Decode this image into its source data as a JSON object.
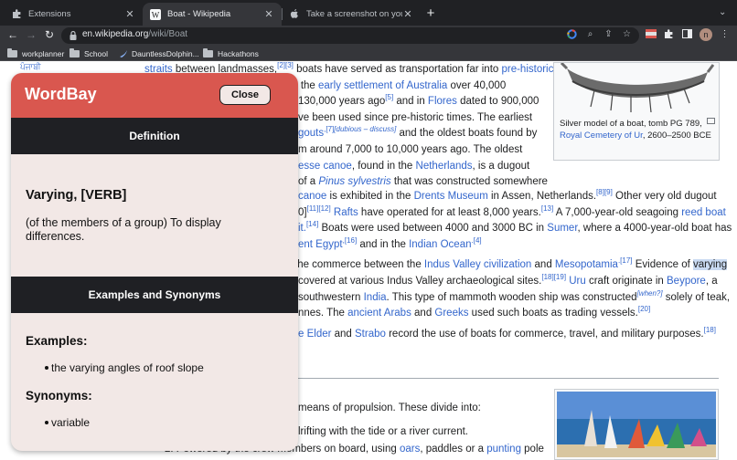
{
  "browser": {
    "tabs": [
      {
        "title": "Extensions",
        "icon": "puzzle-icon"
      },
      {
        "title": "Boat - Wikipedia",
        "icon": "wikipedia-icon"
      },
      {
        "title": "Take a screenshot on your Mac",
        "icon": "apple-icon"
      }
    ],
    "url_host": "en.wikipedia.org",
    "url_path": "/wiki/Boat",
    "bookmarks": [
      "workplanner",
      "School",
      "DauntlessDolphin...",
      "Hackathons"
    ],
    "profile_initial": "n"
  },
  "wiki": {
    "lang_link": "ਪੰਜਾਬੀ",
    "p1": {
      "l1a": "straits",
      "l1b": " between landmasses,",
      "l1c": "[2][3]",
      "l1d": " boats have served as transportation far into ",
      "l1e": "pre-historic",
      "l2a": "such as the ",
      "l2b": "early settlement of Australia",
      "l2c": " over 40,000",
      "l3a": "130,000 years ago",
      "l3b": "[5]",
      "l3c": " and in ",
      "l3d": "Flores",
      "l3e": " dated to 900,000",
      "l4a": "ve been used since pre-historic times. The earliest",
      "l5a": "gouts",
      "l5b": ",[7]",
      "l5c": "[dubious – discuss]",
      "l5d": " and the oldest boats found by",
      "l6a": "m around 7,000 to 10,000 years ago. The oldest",
      "l7a": "esse canoe",
      "l7b": ", found in the ",
      "l7c": "Netherlands",
      "l7d": ", is a dugout",
      "l8a": "of a ",
      "l8b": "Pinus sylvestris",
      "l8c": " that was constructed somewhere"
    },
    "wide": {
      "w1a": "canoe",
      "w1b": " is exhibited in the ",
      "w1c": "Drents Museum",
      "w1d": " in Assen, Netherlands.",
      "w1e": "[8][9]",
      "w1f": " Other very old dugout",
      "w2a": "0]",
      "w2b": "[11][12]",
      "w2c": " Rafts",
      "w2d": " have operated for at least 8,000 years.",
      "w2e": "[13]",
      "w2f": " A 7,000-year-old seagoing ",
      "w2g": "reed boat",
      "w3a": "it.",
      "w3b": "[14]",
      "w3c": " Boats were used between 4000 and 3000 BC in ",
      "w3d": "Sumer",
      "w3e": ", where a 4000-year-old boat has",
      "w4a": "ent Egypt",
      "w4b": ",[16]",
      "w4c": " and in the ",
      "w4d": "Indian Ocean",
      "w4e": ".[4]",
      "w5a": " the commerce between the ",
      "w5b": "Indus Valley civilization",
      "w5c": " and ",
      "w5d": "Mesopotamia",
      "w5e": ".[17]",
      "w5f": " Evidence of ",
      "w5g": "varying",
      "w6a": "covered at various Indus Valley archaeological sites.",
      "w6b": "[18][19]",
      "w6c": " Uru",
      "w6d": " craft originate in ",
      "w6e": "Beypore",
      "w6f": ", a",
      "w7a": "southwestern ",
      "w7b": "India",
      "w7c": ". This type of mammoth wooden ship was constructed",
      "w7d": "[when?]",
      "w7e": " solely of teak,",
      "w8a": "nnes. The ",
      "w8b": "ancient Arabs",
      "w8c": " and ",
      "w8d": "Greeks",
      "w8e": " used such boats as trading vessels.",
      "w8f": "[20]",
      "w9a": "e Elder",
      "w9b": " and ",
      "w9c": "Strabo",
      "w9d": " record the use of boats for commerce, travel, and military purposes.",
      "w9e": "[18]",
      "w10a": "means of propulsion. These divide into:",
      "w11a": "lrifting with the tide or a river current.",
      "w12a": "2. Powered by the crew members on board, using ",
      "w12b": "oars",
      "w12c": ", paddles or a ",
      "w12d": "punting",
      "w12e": " pole"
    },
    "infobox_caption": {
      "a": "Silver model of a boat, tomb PG 789, ",
      "b": "Royal Cemetery of Ur",
      "c": ", 2600–2500 BCE"
    }
  },
  "popup": {
    "title": "WordBay",
    "close_label": "Close",
    "definition_header": "Definition",
    "word": "Varying, [VERB]",
    "definition": "(of the members of a group) To display differences.",
    "examples_header": "Examples and Synonyms",
    "examples_label": "Examples:",
    "examples": [
      "the varying angles of roof slope"
    ],
    "synonyms_label": "Synonyms:",
    "synonyms": [
      "variable"
    ],
    "colors": {
      "header": "#d9574f",
      "bar": "#1f2024",
      "body": "#f2e8e6"
    }
  }
}
